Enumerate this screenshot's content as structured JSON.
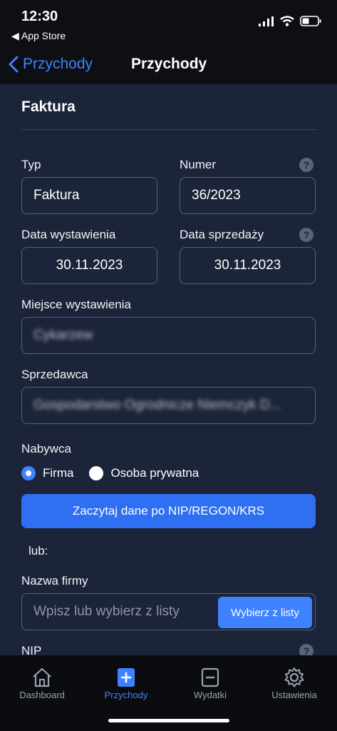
{
  "status": {
    "time": "12:30",
    "back_app": "◀ App Store"
  },
  "nav": {
    "back_label": "Przychody",
    "title": "Przychody"
  },
  "section": {
    "title": "Faktura"
  },
  "form": {
    "type_label": "Typ",
    "type_value": "Faktura",
    "number_label": "Numer",
    "number_value": "36/2023",
    "issue_date_label": "Data wystawienia",
    "issue_date_value": "30.11.2023",
    "sale_date_label": "Data sprzedaży",
    "sale_date_value": "30.11.2023",
    "place_label": "Miejsce wystawienia",
    "place_value": "Cykarzew",
    "seller_label": "Sprzedawca",
    "seller_value": "Gospodarstwo Ogrodnicze Niemczyk D...",
    "buyer_label": "Nabywca",
    "buyer_options": [
      "Firma",
      "Osoba prywatna"
    ],
    "buyer_selected": "Firma",
    "fetch_button": "Zaczytaj dane po NIP/REGON/KRS",
    "or_label": "lub:",
    "company_label": "Nazwa firmy",
    "company_placeholder": "Wpisz lub wybierz z listy",
    "company_pick_button": "Wybierz z listy",
    "nip_label": "NIP",
    "help_glyph": "?"
  },
  "tabs": [
    {
      "label": "Dashboard",
      "icon": "home-icon"
    },
    {
      "label": "Przychody",
      "icon": "plus-square-icon",
      "active": true
    },
    {
      "label": "Wydatki",
      "icon": "minus-square-icon"
    },
    {
      "label": "Ustawienia",
      "icon": "gear-icon"
    }
  ],
  "colors": {
    "accent": "#3f82ff",
    "background": "#1b2438",
    "button": "#2f6ff2"
  }
}
